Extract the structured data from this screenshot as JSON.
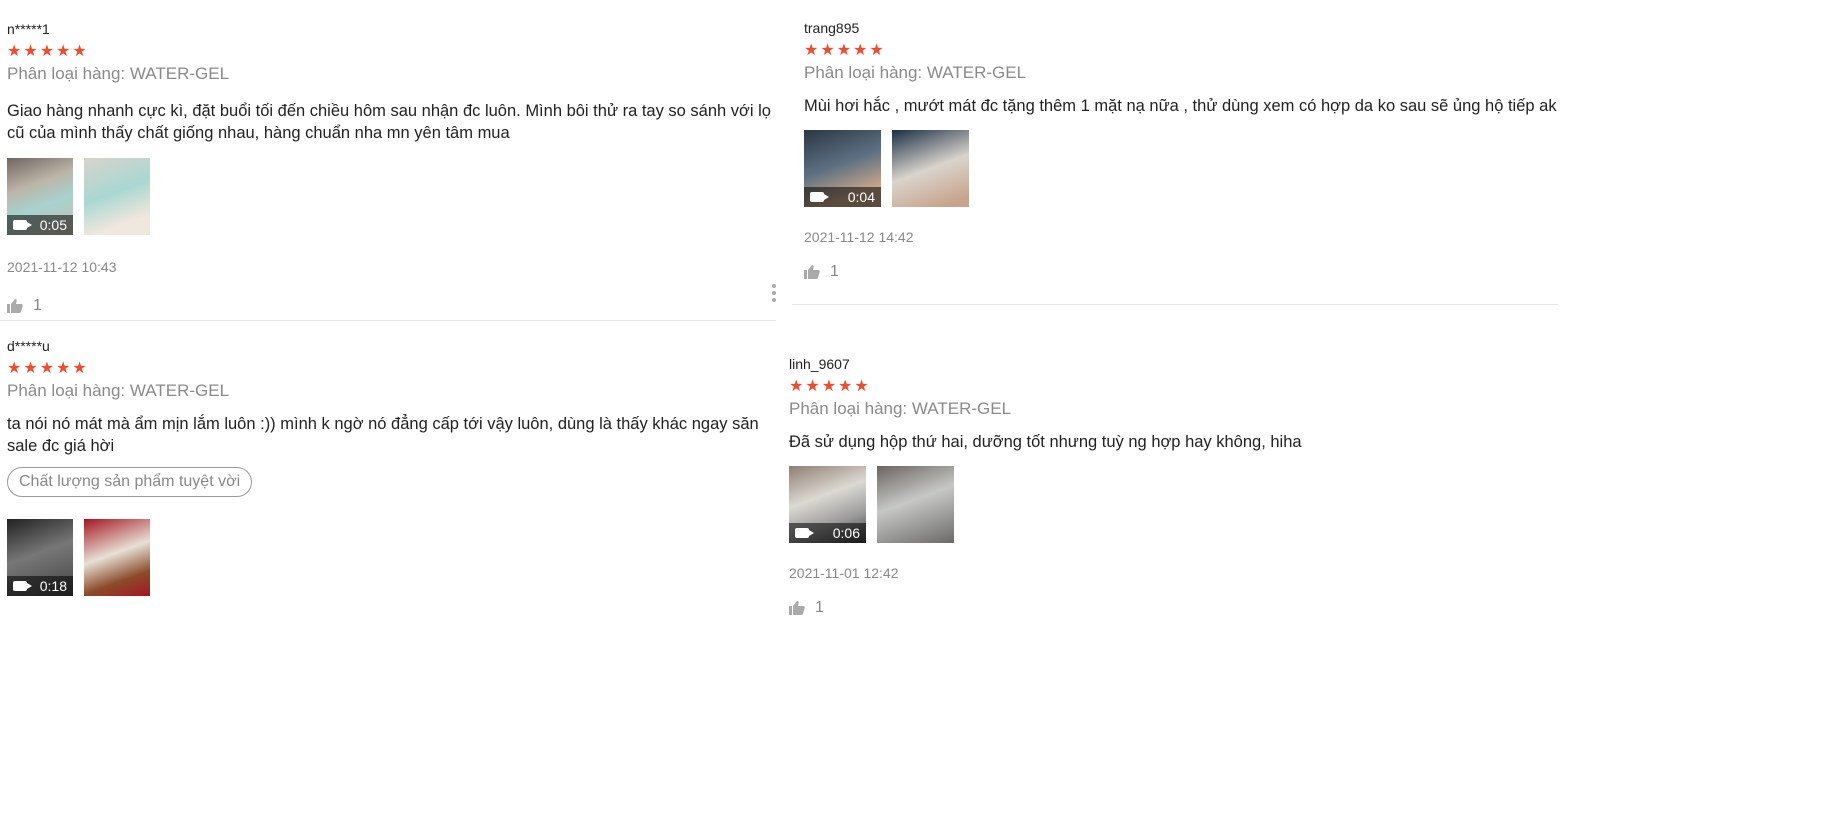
{
  "reviews": [
    {
      "username": "n*****1",
      "stars": 5,
      "variant": "Phân loại hàng: WATER-GEL",
      "text": "Giao hàng nhanh cực kì, đặt buổi tối đến chiều hôm sau nhận đc luôn. Mình bôi thử ra tay so sánh với lọ cũ của mình thấy chất giống nhau, hàng chuẩn nha mn yên tâm mua",
      "tag": "",
      "video_duration": "0:05",
      "timestamp": "2021-11-12 10:43",
      "likes": "1"
    },
    {
      "username": "trang895",
      "stars": 5,
      "variant": "Phân loại hàng: WATER-GEL",
      "text": "Mùi hơi hắc , mướt mát đc tặng thêm 1 mặt nạ nữa , thử dùng xem có hợp da ko sau sẽ ủng hộ tiếp ak",
      "tag": "",
      "video_duration": "0:04",
      "timestamp": "2021-11-12 14:42",
      "likes": "1"
    },
    {
      "username": "d*****u",
      "stars": 5,
      "variant": "Phân loại hàng: WATER-GEL",
      "text": "ta nói nó mát mà ẩm mịn lắm luôn :)) mình k ngờ nó đẳng cấp tới vậy luôn, dùng là thấy khác ngay săn sale đc giá hời",
      "tag": "Chất lượng sản phẩm tuyệt vời",
      "video_duration": "0:18",
      "timestamp": "",
      "likes": ""
    },
    {
      "username": "linh_9607",
      "stars": 5,
      "variant": "Phân loại hàng: WATER-GEL",
      "text": "Đã sử dụng hộp thứ hai,  dưỡng tốt nhưng tuỳ ng hợp hay không, hiha",
      "tag": "",
      "video_duration": "0:06",
      "timestamp": "2021-11-01 12:42",
      "likes": "1"
    }
  ],
  "colors": {
    "star": "#ee4d2d",
    "muted": "#8a8a8a",
    "divider": "#e5e5e5"
  },
  "icons": {
    "star": "star-icon",
    "video": "video-camera-icon",
    "like": "thumbs-up-icon",
    "more": "more-vertical-icon"
  }
}
